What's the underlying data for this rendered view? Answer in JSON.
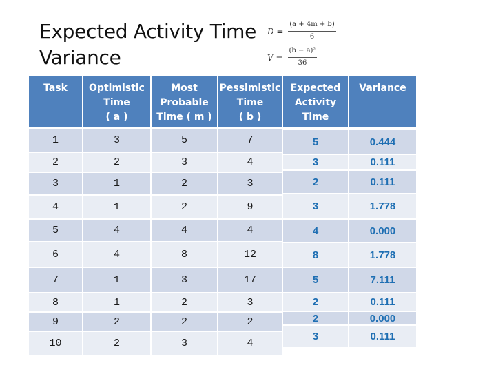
{
  "title": "Expected Activity Time Variance",
  "title_lines": [
    "Expected Activity Time",
    "Variance"
  ],
  "formulas": {
    "expected": {
      "lhs": "D =",
      "numerator": "(a + 4m + b)",
      "denominator": "6"
    },
    "variance": {
      "lhs": "V =",
      "numerator": "(b − a)²",
      "denominator": "36"
    }
  },
  "table": {
    "headers": [
      "Task",
      "Optimistic Time ( a )",
      "Most Probable Time ( m )",
      "Pessimistic Time ( b )",
      "Expected Activity Time",
      "Variance"
    ],
    "header_lines": [
      [
        "Task"
      ],
      [
        "Optimistic",
        "Time",
        "( a )"
      ],
      [
        "Most",
        "Probable",
        "Time ( m )"
      ],
      [
        "Pessimistic",
        "Time",
        "( b )"
      ],
      [
        "Expected",
        "Activity",
        "Time"
      ],
      [
        "Variance"
      ]
    ],
    "rows": [
      {
        "task": "1",
        "a": "3",
        "m": "5",
        "b": "7",
        "expected": "5",
        "variance": "0.444"
      },
      {
        "task": "2",
        "a": "2",
        "m": "3",
        "b": "4",
        "expected": "3",
        "variance": "0.111"
      },
      {
        "task": "3",
        "a": "1",
        "m": "2",
        "b": "3",
        "expected": "2",
        "variance": "0.111"
      },
      {
        "task": "4",
        "a": "1",
        "m": "2",
        "b": "9",
        "expected": "3",
        "variance": "1.778"
      },
      {
        "task": "5",
        "a": "4",
        "m": "4",
        "b": "4",
        "expected": "4",
        "variance": "0.000"
      },
      {
        "task": "6",
        "a": "4",
        "m": "8",
        "b": "12",
        "expected": "8",
        "variance": "1.778"
      },
      {
        "task": "7",
        "a": "1",
        "m": "3",
        "b": "17",
        "expected": "5",
        "variance": "7.111"
      },
      {
        "task": "8",
        "a": "1",
        "m": "2",
        "b": "3",
        "expected": "2",
        "variance": "0.111"
      },
      {
        "task": "9",
        "a": "2",
        "m": "2",
        "b": "2",
        "expected": "2",
        "variance": "0.000"
      },
      {
        "task": "10",
        "a": "2",
        "m": "3",
        "b": "4",
        "expected": "3",
        "variance": "0.111"
      }
    ]
  },
  "colors": {
    "header_bg": "#4f81bd",
    "row_dark": "#d0d8e8",
    "row_light": "#e9edf4",
    "computed_text": "#1f6fb3"
  }
}
